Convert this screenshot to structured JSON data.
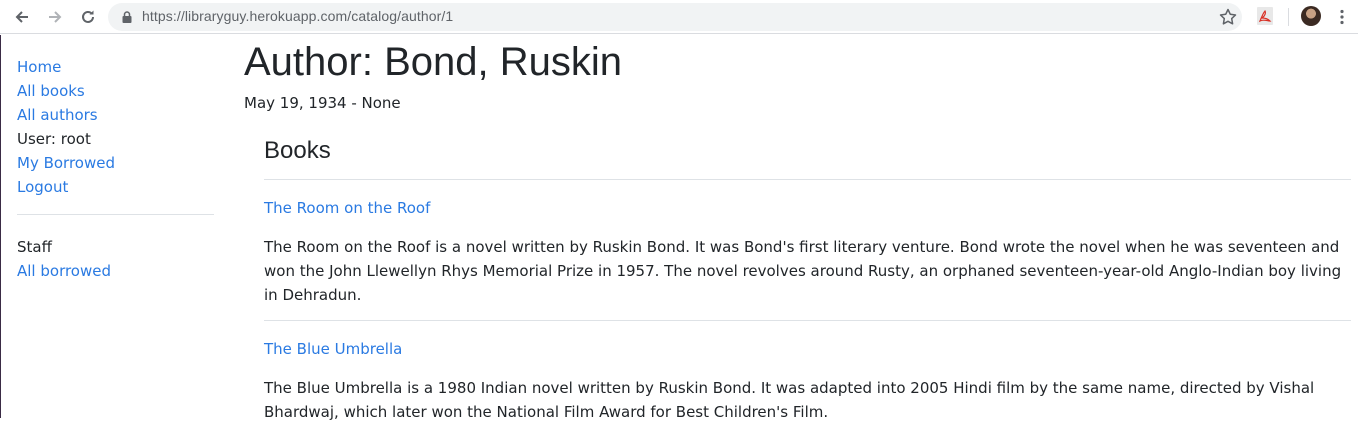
{
  "browser": {
    "url": "https://libraryguy.herokuapp.com/catalog/author/1"
  },
  "sidebar": {
    "links": [
      {
        "label": "Home"
      },
      {
        "label": "All books"
      },
      {
        "label": "All authors"
      }
    ],
    "user_label": "User: root",
    "my_borrowed": "My Borrowed",
    "logout": "Logout",
    "staff_heading": "Staff",
    "all_borrowed": "All borrowed"
  },
  "author": {
    "heading": "Author: Bond, Ruskin",
    "dates": "May 19, 1934 - None"
  },
  "books_section": {
    "heading": "Books",
    "books": [
      {
        "title": "The Room on the Roof",
        "summary": "The Room on the Roof is a novel written by Ruskin Bond. It was Bond's first literary venture. Bond wrote the novel when he was seventeen and won the John Llewellyn Rhys Memorial Prize in 1957. The novel revolves around Rusty, an orphaned seventeen-year-old Anglo-Indian boy living in Dehradun."
      },
      {
        "title": "The Blue Umbrella",
        "summary": "The Blue Umbrella is a 1980 Indian novel written by Ruskin Bond. It was adapted into 2005 Hindi film by the same name, directed by Vishal Bhardwaj, which later won the National Film Award for Best Children's Film."
      }
    ]
  },
  "colors": {
    "link": "#2a7ae2",
    "text": "#212529"
  }
}
